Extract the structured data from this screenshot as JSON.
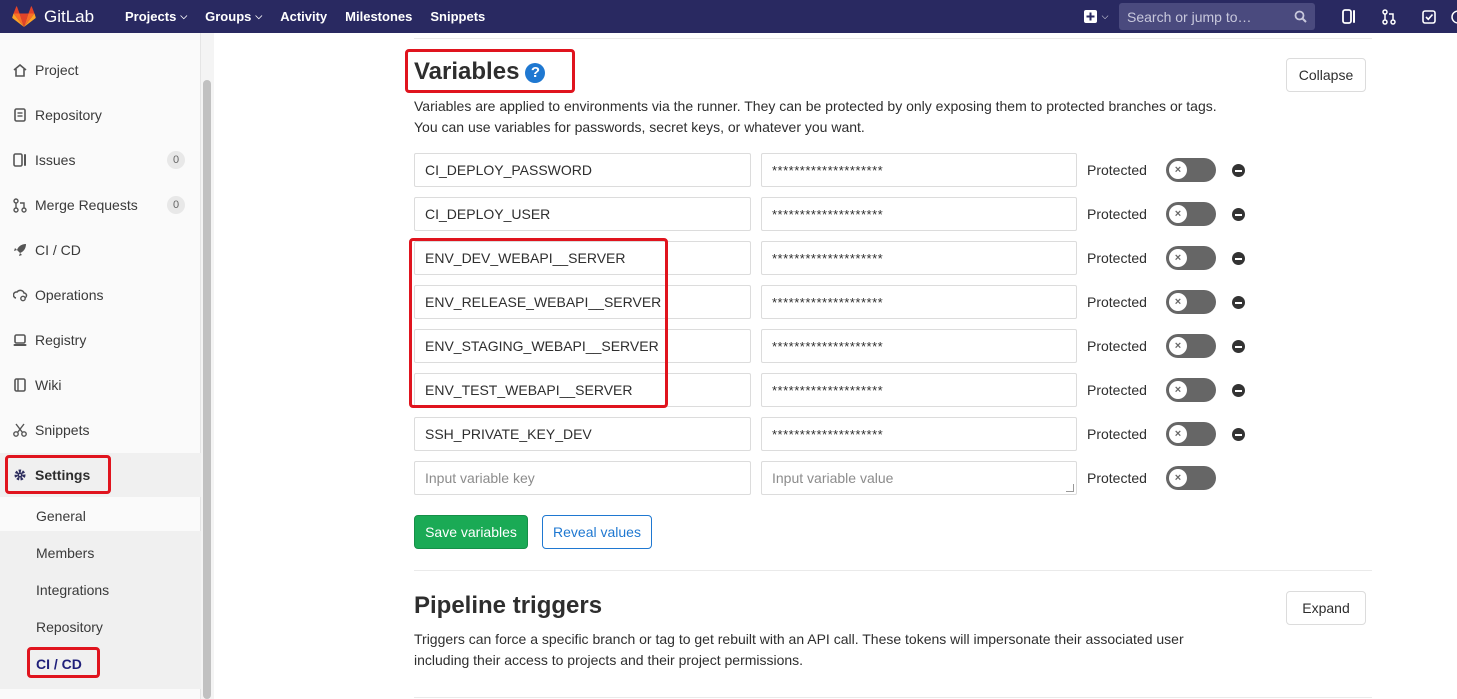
{
  "navbar": {
    "brand": "GitLab",
    "items": [
      {
        "label": "Projects",
        "dropdown": true
      },
      {
        "label": "Groups",
        "dropdown": true
      },
      {
        "label": "Activity",
        "dropdown": false
      },
      {
        "label": "Milestones",
        "dropdown": false
      },
      {
        "label": "Snippets",
        "dropdown": false
      }
    ],
    "search_placeholder": "Search or jump to…",
    "icons": [
      "plus-icon",
      "search-icon",
      "issues-icon",
      "merge-request-icon",
      "todo-icon"
    ]
  },
  "sidebar": {
    "items": [
      {
        "label": "Project",
        "icon": "home-icon"
      },
      {
        "label": "Repository",
        "icon": "doc-icon"
      },
      {
        "label": "Issues",
        "icon": "issues-icon",
        "count": "0"
      },
      {
        "label": "Merge Requests",
        "icon": "merge-request-icon",
        "count": "0"
      },
      {
        "label": "CI / CD",
        "icon": "rocket-icon"
      },
      {
        "label": "Operations",
        "icon": "cloud-gear-icon"
      },
      {
        "label": "Registry",
        "icon": "container-icon"
      },
      {
        "label": "Wiki",
        "icon": "book-icon"
      },
      {
        "label": "Snippets",
        "icon": "scissors-icon"
      },
      {
        "label": "Settings",
        "icon": "gear-icon",
        "active": true
      }
    ],
    "settings_sub": [
      "General",
      "Members",
      "Integrations",
      "Repository",
      "CI / CD"
    ],
    "active_sub": "CI / CD"
  },
  "variables_section": {
    "title": "Variables",
    "description_line1": "Variables are applied to environments via the runner. They can be protected by only exposing them to protected branches or tags.",
    "description_line2": "You can use variables for passwords, secret keys, or whatever you want.",
    "collapse_label": "Collapse",
    "protected_label": "Protected",
    "rows": [
      {
        "key": "CI_DEPLOY_PASSWORD",
        "value": "********************"
      },
      {
        "key": "CI_DEPLOY_USER",
        "value": "********************"
      },
      {
        "key": "ENV_DEV_WEBAPI__SERVER",
        "value": "********************"
      },
      {
        "key": "ENV_RELEASE_WEBAPI__SERVER",
        "value": "********************"
      },
      {
        "key": "ENV_STAGING_WEBAPI__SERVER",
        "value": "********************"
      },
      {
        "key": "ENV_TEST_WEBAPI__SERVER",
        "value": "********************"
      },
      {
        "key": "SSH_PRIVATE_KEY_DEV",
        "value": "********************"
      }
    ],
    "new_key_placeholder": "Input variable key",
    "new_value_placeholder": "Input variable value",
    "save_label": "Save variables",
    "reveal_label": "Reveal values"
  },
  "triggers_section": {
    "title": "Pipeline triggers",
    "description_line1": "Triggers can force a specific branch or tag to get rebuilt with an API call. These tokens will impersonate their associated user",
    "description_line2": "including their access to projects and their project permissions.",
    "expand_label": "Expand"
  },
  "colors": {
    "navbar": "#292961",
    "primary_green": "#1aaa55",
    "link_blue": "#1f78d1",
    "highlight_red": "#e0141e"
  }
}
